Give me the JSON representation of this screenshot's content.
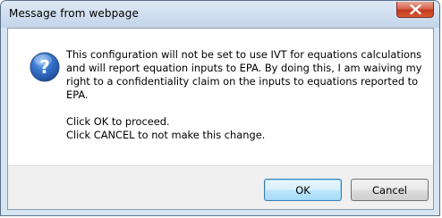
{
  "window": {
    "title": "Message from webpage"
  },
  "dialog": {
    "icon": "question-icon",
    "paragraphs": [
      "This configuration will not be set to use IVT for equations calculations\nand will report equation inputs to EPA.  By doing this, I am waiving my\nright to a confidentiality claim on the inputs to equations reported to\nEPA.",
      "Click OK to proceed.\nClick CANCEL to not make this change."
    ]
  },
  "buttons": {
    "ok_label": "OK",
    "cancel_label": "Cancel"
  },
  "colors": {
    "titlebar": "#cfdeef",
    "close_button": "#c13a1f",
    "icon_blue": "#1f4e9c",
    "default_button_border": "#3c7fb1"
  }
}
